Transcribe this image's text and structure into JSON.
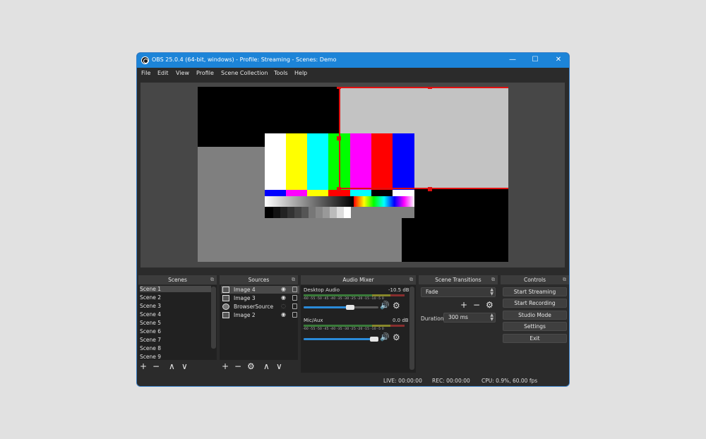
{
  "window": {
    "title": "OBS 25.0.4 (64-bit, windows) - Profile: Streaming - Scenes: Demo",
    "minimize": "—",
    "maximize": "☐",
    "close": "✕"
  },
  "menu": [
    "File",
    "Edit",
    "View",
    "Profile",
    "Scene Collection",
    "Tools",
    "Help"
  ],
  "docks": {
    "scenes": {
      "title": "Scenes",
      "items": [
        "Scene 1",
        "Scene 2",
        "Scene 3",
        "Scene 4",
        "Scene 5",
        "Scene 6",
        "Scene 7",
        "Scene 8",
        "Scene 9"
      ],
      "selected": "Scene 1"
    },
    "sources": {
      "title": "Sources",
      "items": [
        {
          "name": "Image 4",
          "icon": "image-icon",
          "visible": true
        },
        {
          "name": "Image 3",
          "icon": "image-icon",
          "visible": true
        },
        {
          "name": "BrowserSource",
          "icon": "globe-icon",
          "visible": false
        },
        {
          "name": "Image 2",
          "icon": "image-icon",
          "visible": true
        }
      ]
    },
    "mixer": {
      "title": "Audio Mixer",
      "channels": [
        {
          "name": "Desktop Audio",
          "db": "-10.5 dB",
          "volume": 0.62
        },
        {
          "name": "Mic/Aux",
          "db": "0.0 dB",
          "volume": 1.0
        }
      ],
      "ticks": "-60  -55  -50  -45  -40  -35  -30  -25  -20  -15  -10   -5    0"
    },
    "transitions": {
      "title": "Scene Transitions",
      "selected": "Fade",
      "duration_label": "Duration",
      "duration_value": "300 ms"
    },
    "controls": {
      "title": "Controls",
      "buttons": [
        "Start Streaming",
        "Start Recording",
        "Studio Mode",
        "Settings",
        "Exit"
      ]
    }
  },
  "toolbar_glyphs": {
    "add": "+",
    "remove": "−",
    "up": "∧",
    "down": "∨",
    "gear": "⚙",
    "float": "⧉"
  },
  "status": {
    "live": "LIVE: 00:00:00",
    "rec": "REC: 00:00:00",
    "cpu": "CPU: 0.9%, 60.00 fps"
  },
  "colors": {
    "titlebar": "#1c84d8",
    "selection": "#e01010",
    "slider": "#2a8ad8"
  }
}
